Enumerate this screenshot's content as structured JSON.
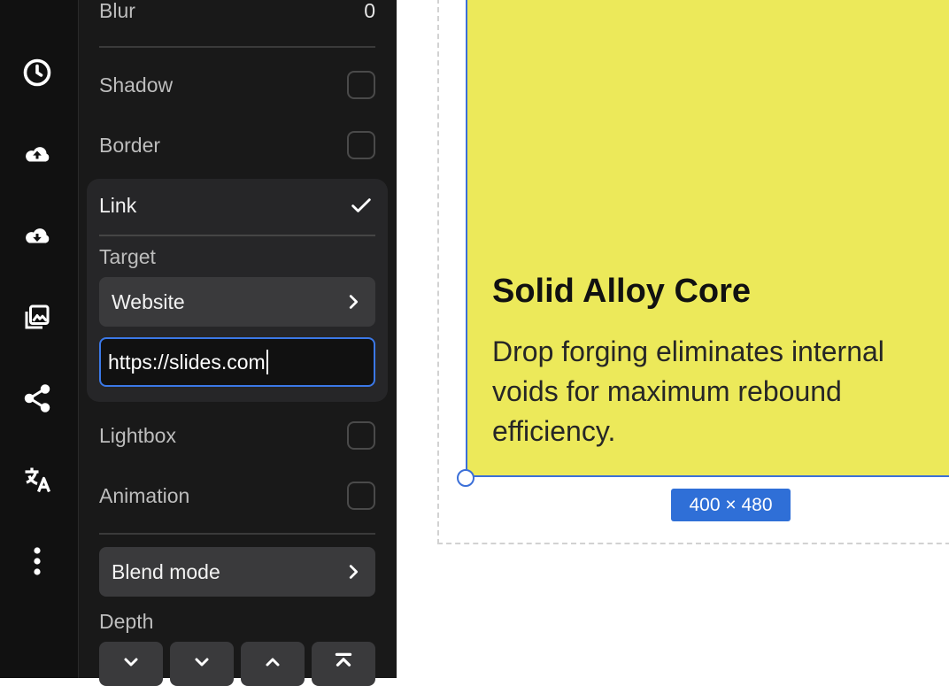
{
  "rail": {
    "icons": [
      "layout-icon",
      "history-icon",
      "upload-cloud-icon",
      "download-cloud-icon",
      "gallery-icon",
      "share-icon",
      "translate-icon",
      "more-icon"
    ]
  },
  "panel": {
    "blur": {
      "label": "Blur",
      "value": "0"
    },
    "shadow": {
      "label": "Shadow",
      "checked": false
    },
    "border": {
      "label": "Border",
      "checked": false
    },
    "link": {
      "label": "Link",
      "checked": true,
      "target_label": "Target",
      "target_value": "Website",
      "url_value": "https://slides.com"
    },
    "lightbox": {
      "label": "Lightbox",
      "checked": false
    },
    "animation": {
      "label": "Animation",
      "checked": false
    },
    "blend_mode": {
      "label": "Blend mode"
    },
    "depth": {
      "label": "Depth",
      "buttons": [
        "send-backward-icon",
        "send-to-back-icon",
        "bring-forward-icon",
        "bring-to-front-icon"
      ]
    }
  },
  "canvas": {
    "card": {
      "title": "Solid Alloy Core",
      "body": "Drop forging eliminates internal voids for maximum rebound efficiency.",
      "background": "#ece95a"
    },
    "size_badge": "400 × 480",
    "selection_color": "#3b6fd8"
  }
}
